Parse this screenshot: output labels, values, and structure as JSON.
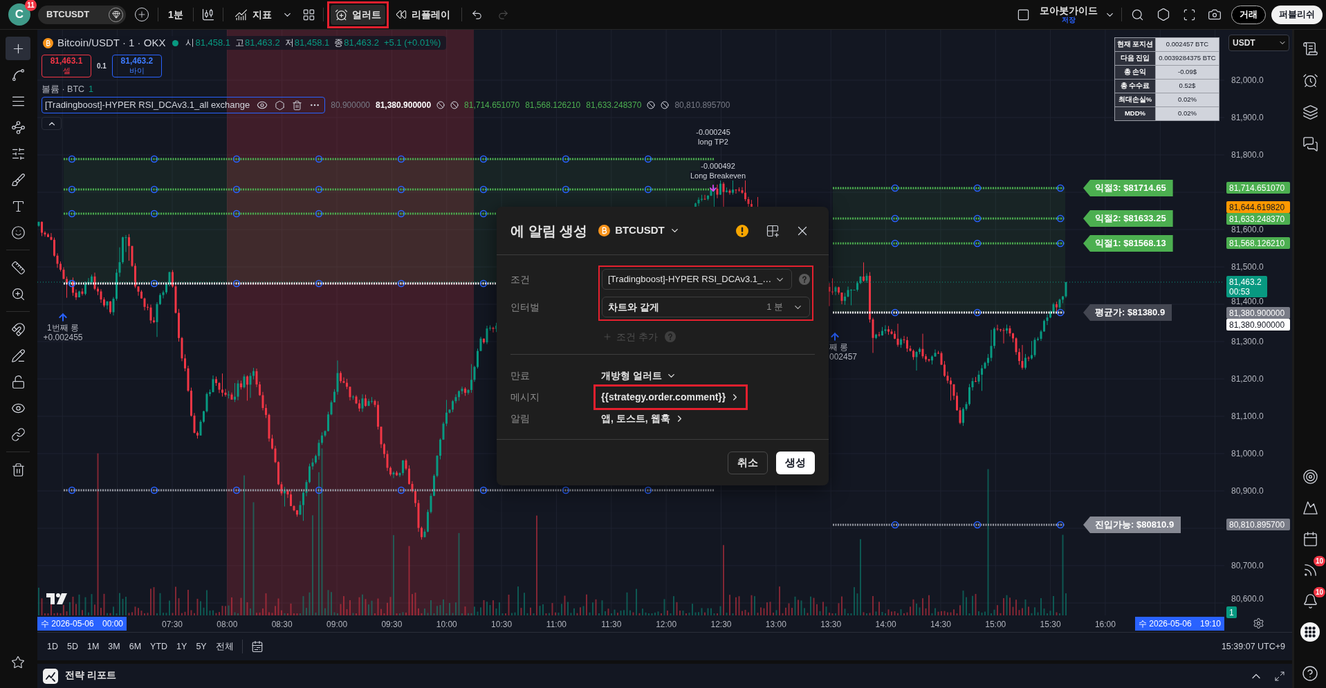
{
  "top_bar": {
    "avatar": {
      "letter": "C",
      "badge": "11"
    },
    "symbol": "BTCUSDT",
    "interval": "1분",
    "indicators": "지표",
    "alert": {
      "label": "얼러트",
      "highlighted": true
    },
    "replay": "리플레이",
    "undo": {
      "disabled": false
    },
    "redo": {
      "disabled": true
    },
    "layout": {
      "name": "모아봇가이드",
      "status": "저장"
    },
    "trade": "거래",
    "publish": "퍼블리쉬"
  },
  "left_toolbar": {
    "tools": [
      {
        "selected": true
      },
      {
        "selected": false
      },
      {
        "selected": false
      },
      {
        "selected": false
      },
      {
        "selected": false
      },
      {
        "selected": false
      },
      {
        "selected": false
      },
      {
        "selected": false
      },
      {
        "selected": false
      },
      {
        "selected": false
      },
      {
        "selected": false
      },
      {
        "selected": false
      },
      {
        "selected": false
      },
      {
        "selected": false
      },
      {
        "selected": false
      },
      {
        "selected": false
      }
    ]
  },
  "legend": {
    "title": "Bitcoin/USDT · 1 · OKX",
    "ohlc": [
      {
        "label": "시",
        "value": "81,458.1"
      },
      {
        "label": "고",
        "value": "81,463.2"
      },
      {
        "label": "저",
        "value": "81,458.1"
      },
      {
        "label": "종",
        "value": "81,463.2"
      }
    ],
    "change": "+5.1 (+0.01%)",
    "sell": {
      "price": "81,463.1",
      "label": "셀"
    },
    "spread": "0.1",
    "buy": {
      "price": "81,463.2",
      "label": "바이"
    },
    "volume": {
      "label": "볼륨 · BTC",
      "value": "1"
    },
    "indicator": {
      "name": "[Tradingboost]-HYPER RSI_DCAv3.1_all exchange",
      "values": [
        {
          "kind": "value",
          "text": "80.900000",
          "color": "#787b86"
        },
        {
          "kind": "value",
          "text": "81,380.900000",
          "color": "#ffffff"
        },
        {
          "kind": "na"
        },
        {
          "kind": "na"
        },
        {
          "kind": "value",
          "text": "81,714.651070",
          "color": "#4caf50"
        },
        {
          "kind": "value",
          "text": "81,568.126210",
          "color": "#4caf50"
        },
        {
          "kind": "value",
          "text": "81,633.248370",
          "color": "#4caf50"
        },
        {
          "kind": "na"
        },
        {
          "kind": "na"
        },
        {
          "kind": "value",
          "text": "80,810.895700",
          "color": "#787b86"
        }
      ]
    }
  },
  "stats_table": {
    "rows": [
      {
        "label": "현재 포지션",
        "value": "0.002457 BTC"
      },
      {
        "label": "다음 진입",
        "value": "0.0039284375 BTC"
      },
      {
        "label": "총 손익",
        "value": "-0.09$"
      },
      {
        "label": "총 수수료",
        "value": "0.52$"
      },
      {
        "label": "최대손실%",
        "value": "0.02%"
      },
      {
        "label": "MDD%",
        "value": "0.02%"
      }
    ]
  },
  "chart": {
    "annotations": [
      {
        "kind": "entry",
        "lines": [
          "1번째 롱",
          "+0.002455"
        ]
      },
      {
        "kind": "entry",
        "lines": [
          "째 롱",
          "002457"
        ]
      },
      {
        "kind": "note",
        "lines": [
          "-0.000245",
          "long TP2"
        ]
      },
      {
        "kind": "note",
        "lines": [
          "-0.000492",
          "Long Breakeven"
        ]
      }
    ],
    "level_labels": [
      {
        "kind": "take_profit",
        "text": "익절3: $81714.65"
      },
      {
        "kind": "take_profit",
        "text": "익절2: $81633.25"
      },
      {
        "kind": "take_profit",
        "text": "익절1: $81568.13"
      },
      {
        "kind": "average",
        "text": "평균가: $81380.9"
      },
      {
        "kind": "entry",
        "text": "진입가능: $80810.9"
      }
    ]
  },
  "price_axis": {
    "currency": "USDT",
    "ticks": [
      "82,000.0",
      "81,900.0",
      "81,800.0",
      "81,600.0",
      "81,500.0",
      "81,400.0",
      "81,300.0",
      "81,200.0",
      "81,100.0",
      "81,000.0",
      "80,900.0",
      "80,700.0",
      "80,600.0"
    ],
    "tags": [
      {
        "text": "81,714.651070",
        "color": "#4caf50"
      },
      {
        "text": "81,644.619820",
        "color": "#ff9800"
      },
      {
        "text": "81,633.248370",
        "color": "#4caf50"
      },
      {
        "text": "81,568.126210",
        "color": "#4caf50"
      },
      {
        "text": "81,463.2",
        "sub": "00:53",
        "color": "#089981"
      },
      {
        "text": "81,380.900000",
        "color": "#787b86"
      },
      {
        "text": "81,380.900000",
        "color": "#ffffff"
      },
      {
        "text": "80,810.895700",
        "color": "#787b86"
      },
      {
        "text": "1",
        "color": "#089981"
      }
    ]
  },
  "time_axis": {
    "start": {
      "date": "수 2026-05-06",
      "time": "00:00"
    },
    "ticks": [
      "07:30",
      "08:00",
      "08:30",
      "09:00",
      "09:30",
      "10:00",
      "10:30",
      "11:00",
      "11:30",
      "12:00",
      "12:30",
      "13:00",
      "13:30",
      "14:00",
      "14:30",
      "15:00",
      "15:30",
      "16:00"
    ],
    "end": {
      "date": "수 2026-05-06",
      "time": "19:10"
    }
  },
  "range_bar": {
    "ranges": [
      "1D",
      "5D",
      "1M",
      "3M",
      "6M",
      "YTD",
      "1Y",
      "5Y",
      "전체"
    ],
    "clock": "15:39:07 UTC+9"
  },
  "bottom_panel": {
    "title": "전략 리포트"
  },
  "right_sidebar": {
    "feed_badge": "10",
    "alerts_badge": "10"
  },
  "alert_dialog": {
    "title": "에 알림 생성",
    "symbol": "BTCUSDT",
    "trigger": {
      "highlighted": true,
      "condition": {
        "label": "조건",
        "value": "[Tradingboost]-HYPER RSI_DCAv3.1_…"
      },
      "interval": {
        "label": "인터벌",
        "value": "차트와 같게",
        "unit": "1 분"
      }
    },
    "add_condition": {
      "label": "조건 추가",
      "disabled": true
    },
    "settings": [
      {
        "kind": "dropdown",
        "label": "만료",
        "value": "개방형 얼러트",
        "highlighted": false
      },
      {
        "kind": "link",
        "label": "메시지",
        "value": "{{strategy.order.comment}}",
        "highlighted": true
      },
      {
        "kind": "link",
        "label": "알림",
        "value": "앱, 토스트, 웹훅",
        "highlighted": false
      }
    ],
    "buttons": [
      {
        "kind": "secondary",
        "label": "취소"
      },
      {
        "kind": "primary",
        "label": "생성"
      }
    ]
  }
}
